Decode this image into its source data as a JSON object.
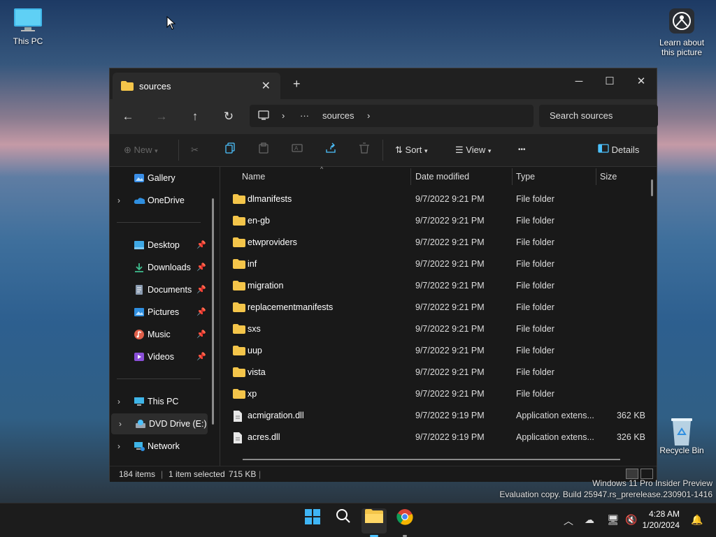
{
  "desktop": {
    "this_pc": "This PC",
    "learn_line1": "Learn about",
    "learn_line2": "this picture",
    "recycle_bin": "Recycle Bin",
    "watermark_line1": "Windows 11 Pro Insider Preview",
    "watermark_line2": "Evaluation copy. Build 25947.rs_prerelease.230901-1416"
  },
  "window": {
    "tab_title": "sources",
    "breadcrumb_ellipsis": "···",
    "breadcrumb_current": "sources",
    "search_placeholder": "Search sources",
    "toolbar": {
      "new": "New",
      "sort": "Sort",
      "view": "View",
      "more": "•••",
      "details": "Details"
    }
  },
  "sidebar": {
    "items": [
      {
        "label": "Gallery"
      },
      {
        "label": "OneDrive"
      },
      {
        "label": "Desktop"
      },
      {
        "label": "Downloads"
      },
      {
        "label": "Documents"
      },
      {
        "label": "Pictures"
      },
      {
        "label": "Music"
      },
      {
        "label": "Videos"
      },
      {
        "label": "This PC"
      },
      {
        "label": "DVD Drive (E:) C"
      },
      {
        "label": "Network"
      }
    ]
  },
  "columns": [
    "Name",
    "Date modified",
    "Type",
    "Size"
  ],
  "files": [
    {
      "name": "dlmanifests",
      "date": "9/7/2022 9:21 PM",
      "type": "File folder",
      "size": ""
    },
    {
      "name": "en-gb",
      "date": "9/7/2022 9:21 PM",
      "type": "File folder",
      "size": ""
    },
    {
      "name": "etwproviders",
      "date": "9/7/2022 9:21 PM",
      "type": "File folder",
      "size": ""
    },
    {
      "name": "inf",
      "date": "9/7/2022 9:21 PM",
      "type": "File folder",
      "size": ""
    },
    {
      "name": "migration",
      "date": "9/7/2022 9:21 PM",
      "type": "File folder",
      "size": ""
    },
    {
      "name": "replacementmanifests",
      "date": "9/7/2022 9:21 PM",
      "type": "File folder",
      "size": ""
    },
    {
      "name": "sxs",
      "date": "9/7/2022 9:21 PM",
      "type": "File folder",
      "size": ""
    },
    {
      "name": "uup",
      "date": "9/7/2022 9:21 PM",
      "type": "File folder",
      "size": ""
    },
    {
      "name": "vista",
      "date": "9/7/2022 9:21 PM",
      "type": "File folder",
      "size": ""
    },
    {
      "name": "xp",
      "date": "9/7/2022 9:21 PM",
      "type": "File folder",
      "size": ""
    },
    {
      "name": "acmigration.dll",
      "date": "9/7/2022 9:19 PM",
      "type": "Application extens...",
      "size": "362 KB"
    },
    {
      "name": "acres.dll",
      "date": "9/7/2022 9:19 PM",
      "type": "Application extens...",
      "size": "326 KB"
    }
  ],
  "status": {
    "item_count": "184 items",
    "selection": "1 item selected",
    "selection_size": "715 KB"
  },
  "taskbar": {
    "time": "4:28 AM",
    "date": "1/20/2024"
  },
  "colors": {
    "folder": "#f4c54a",
    "accent": "#4cc2ff",
    "window_bg": "#191919"
  }
}
